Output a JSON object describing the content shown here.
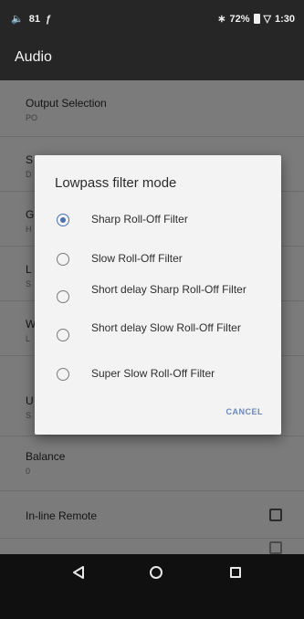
{
  "status_bar": {
    "left_items": [
      "81"
    ],
    "battery": "72%",
    "time": "1:30"
  },
  "app_bar": {
    "title": "Audio"
  },
  "settings": [
    {
      "title": "Output Selection",
      "subtitle": "PO"
    },
    {
      "title": "S",
      "subtitle": "D"
    },
    {
      "title": "G",
      "subtitle": "H"
    },
    {
      "title": "L",
      "subtitle": "S"
    },
    {
      "title": "W",
      "subtitle": "L"
    },
    {
      "title": "U",
      "subtitle": "S"
    },
    {
      "title": "Balance",
      "subtitle": "0"
    },
    {
      "title": "In-line Remote",
      "subtitle": ""
    }
  ],
  "dialog": {
    "title": "Lowpass filter mode",
    "options": [
      {
        "label": "Sharp Roll-Off Filter",
        "selected": true
      },
      {
        "label": "Slow Roll-Off Filter",
        "selected": false
      },
      {
        "label": "Short delay Sharp Roll-Off Filter",
        "selected": false
      },
      {
        "label": "Short delay Slow Roll-Off Filter",
        "selected": false
      },
      {
        "label": "Super Slow Roll-Off Filter",
        "selected": false
      }
    ],
    "cancel_label": "CANCEL"
  },
  "nav_bar": {
    "icons": [
      "back-icon",
      "home-icon",
      "recents-icon"
    ]
  },
  "colors": {
    "accent": "#4a6fb3",
    "dialog_bg": "#f3f3f3",
    "dim_bg": "#7b7b7b"
  }
}
